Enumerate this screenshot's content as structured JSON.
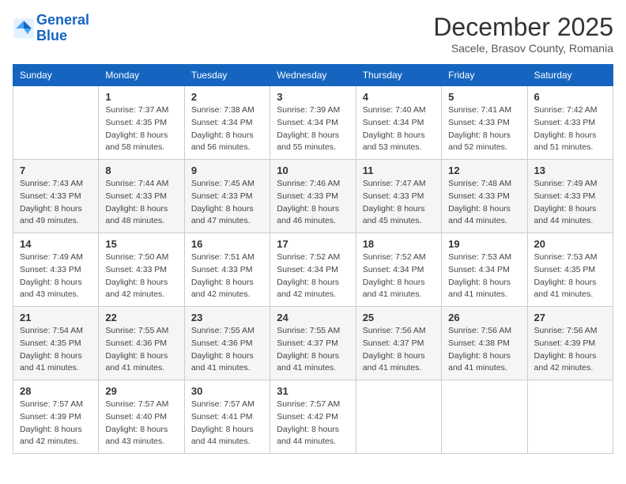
{
  "logo": {
    "text_general": "General",
    "text_blue": "Blue"
  },
  "header": {
    "month": "December 2025",
    "location": "Sacele, Brasov County, Romania"
  },
  "days_of_week": [
    "Sunday",
    "Monday",
    "Tuesday",
    "Wednesday",
    "Thursday",
    "Friday",
    "Saturday"
  ],
  "weeks": [
    [
      {
        "day": "",
        "sunrise": "",
        "sunset": "",
        "daylight": ""
      },
      {
        "day": "1",
        "sunrise": "Sunrise: 7:37 AM",
        "sunset": "Sunset: 4:35 PM",
        "daylight": "Daylight: 8 hours and 58 minutes."
      },
      {
        "day": "2",
        "sunrise": "Sunrise: 7:38 AM",
        "sunset": "Sunset: 4:34 PM",
        "daylight": "Daylight: 8 hours and 56 minutes."
      },
      {
        "day": "3",
        "sunrise": "Sunrise: 7:39 AM",
        "sunset": "Sunset: 4:34 PM",
        "daylight": "Daylight: 8 hours and 55 minutes."
      },
      {
        "day": "4",
        "sunrise": "Sunrise: 7:40 AM",
        "sunset": "Sunset: 4:34 PM",
        "daylight": "Daylight: 8 hours and 53 minutes."
      },
      {
        "day": "5",
        "sunrise": "Sunrise: 7:41 AM",
        "sunset": "Sunset: 4:33 PM",
        "daylight": "Daylight: 8 hours and 52 minutes."
      },
      {
        "day": "6",
        "sunrise": "Sunrise: 7:42 AM",
        "sunset": "Sunset: 4:33 PM",
        "daylight": "Daylight: 8 hours and 51 minutes."
      }
    ],
    [
      {
        "day": "7",
        "sunrise": "Sunrise: 7:43 AM",
        "sunset": "Sunset: 4:33 PM",
        "daylight": "Daylight: 8 hours and 49 minutes."
      },
      {
        "day": "8",
        "sunrise": "Sunrise: 7:44 AM",
        "sunset": "Sunset: 4:33 PM",
        "daylight": "Daylight: 8 hours and 48 minutes."
      },
      {
        "day": "9",
        "sunrise": "Sunrise: 7:45 AM",
        "sunset": "Sunset: 4:33 PM",
        "daylight": "Daylight: 8 hours and 47 minutes."
      },
      {
        "day": "10",
        "sunrise": "Sunrise: 7:46 AM",
        "sunset": "Sunset: 4:33 PM",
        "daylight": "Daylight: 8 hours and 46 minutes."
      },
      {
        "day": "11",
        "sunrise": "Sunrise: 7:47 AM",
        "sunset": "Sunset: 4:33 PM",
        "daylight": "Daylight: 8 hours and 45 minutes."
      },
      {
        "day": "12",
        "sunrise": "Sunrise: 7:48 AM",
        "sunset": "Sunset: 4:33 PM",
        "daylight": "Daylight: 8 hours and 44 minutes."
      },
      {
        "day": "13",
        "sunrise": "Sunrise: 7:49 AM",
        "sunset": "Sunset: 4:33 PM",
        "daylight": "Daylight: 8 hours and 44 minutes."
      }
    ],
    [
      {
        "day": "14",
        "sunrise": "Sunrise: 7:49 AM",
        "sunset": "Sunset: 4:33 PM",
        "daylight": "Daylight: 8 hours and 43 minutes."
      },
      {
        "day": "15",
        "sunrise": "Sunrise: 7:50 AM",
        "sunset": "Sunset: 4:33 PM",
        "daylight": "Daylight: 8 hours and 42 minutes."
      },
      {
        "day": "16",
        "sunrise": "Sunrise: 7:51 AM",
        "sunset": "Sunset: 4:33 PM",
        "daylight": "Daylight: 8 hours and 42 minutes."
      },
      {
        "day": "17",
        "sunrise": "Sunrise: 7:52 AM",
        "sunset": "Sunset: 4:34 PM",
        "daylight": "Daylight: 8 hours and 42 minutes."
      },
      {
        "day": "18",
        "sunrise": "Sunrise: 7:52 AM",
        "sunset": "Sunset: 4:34 PM",
        "daylight": "Daylight: 8 hours and 41 minutes."
      },
      {
        "day": "19",
        "sunrise": "Sunrise: 7:53 AM",
        "sunset": "Sunset: 4:34 PM",
        "daylight": "Daylight: 8 hours and 41 minutes."
      },
      {
        "day": "20",
        "sunrise": "Sunrise: 7:53 AM",
        "sunset": "Sunset: 4:35 PM",
        "daylight": "Daylight: 8 hours and 41 minutes."
      }
    ],
    [
      {
        "day": "21",
        "sunrise": "Sunrise: 7:54 AM",
        "sunset": "Sunset: 4:35 PM",
        "daylight": "Daylight: 8 hours and 41 minutes."
      },
      {
        "day": "22",
        "sunrise": "Sunrise: 7:55 AM",
        "sunset": "Sunset: 4:36 PM",
        "daylight": "Daylight: 8 hours and 41 minutes."
      },
      {
        "day": "23",
        "sunrise": "Sunrise: 7:55 AM",
        "sunset": "Sunset: 4:36 PM",
        "daylight": "Daylight: 8 hours and 41 minutes."
      },
      {
        "day": "24",
        "sunrise": "Sunrise: 7:55 AM",
        "sunset": "Sunset: 4:37 PM",
        "daylight": "Daylight: 8 hours and 41 minutes."
      },
      {
        "day": "25",
        "sunrise": "Sunrise: 7:56 AM",
        "sunset": "Sunset: 4:37 PM",
        "daylight": "Daylight: 8 hours and 41 minutes."
      },
      {
        "day": "26",
        "sunrise": "Sunrise: 7:56 AM",
        "sunset": "Sunset: 4:38 PM",
        "daylight": "Daylight: 8 hours and 41 minutes."
      },
      {
        "day": "27",
        "sunrise": "Sunrise: 7:56 AM",
        "sunset": "Sunset: 4:39 PM",
        "daylight": "Daylight: 8 hours and 42 minutes."
      }
    ],
    [
      {
        "day": "28",
        "sunrise": "Sunrise: 7:57 AM",
        "sunset": "Sunset: 4:39 PM",
        "daylight": "Daylight: 8 hours and 42 minutes."
      },
      {
        "day": "29",
        "sunrise": "Sunrise: 7:57 AM",
        "sunset": "Sunset: 4:40 PM",
        "daylight": "Daylight: 8 hours and 43 minutes."
      },
      {
        "day": "30",
        "sunrise": "Sunrise: 7:57 AM",
        "sunset": "Sunset: 4:41 PM",
        "daylight": "Daylight: 8 hours and 44 minutes."
      },
      {
        "day": "31",
        "sunrise": "Sunrise: 7:57 AM",
        "sunset": "Sunset: 4:42 PM",
        "daylight": "Daylight: 8 hours and 44 minutes."
      },
      {
        "day": "",
        "sunrise": "",
        "sunset": "",
        "daylight": ""
      },
      {
        "day": "",
        "sunrise": "",
        "sunset": "",
        "daylight": ""
      },
      {
        "day": "",
        "sunrise": "",
        "sunset": "",
        "daylight": ""
      }
    ]
  ]
}
